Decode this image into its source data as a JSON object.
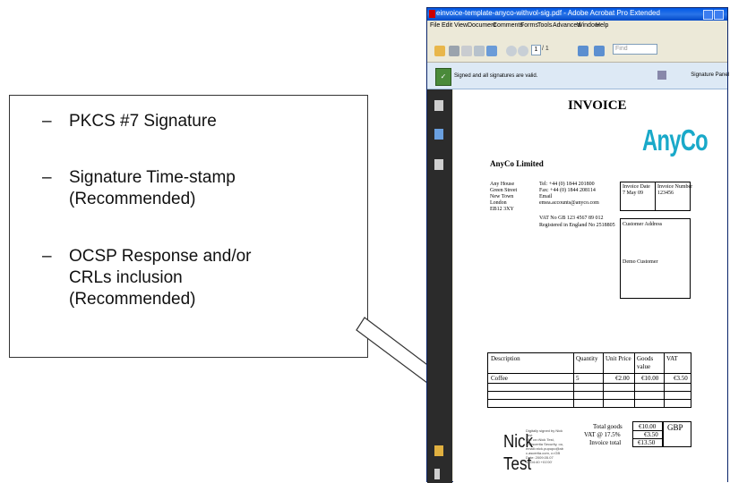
{
  "callout": {
    "bullets": [
      "PKCS #7 Signature",
      "Signature Time-stamp (Recommended)",
      "OCSP Response and/or CRLs inclusion (Recommended)"
    ],
    "dash": "–"
  },
  "window": {
    "title": "einvoice-template-anyco-withvol-sig.pdf - Adobe Acrobat Pro Extended",
    "menu": [
      "File",
      "Edit",
      "View",
      "Document",
      "Comments",
      "Forms",
      "Tools",
      "Advanced",
      "Window",
      "Help"
    ],
    "toolbar": {
      "page_value": "1",
      "page_count": "/ 1",
      "find_placeholder": "Find"
    },
    "signature_bar": {
      "message": "Signed and all signatures are valid.",
      "panel_button": "Signature Panel"
    }
  },
  "invoice": {
    "heading": "INVOICE",
    "logo": "AnyCo",
    "company": "AnyCo Limited",
    "address": [
      "Any House",
      "Green Street",
      "New Town",
      "London",
      "EB12 3XY"
    ],
    "contact": [
      "Tel: +44 (0) 1844 201800",
      "Fax: +44 (0) 1844 208114",
      "Email",
      "emea.accounts@anyco.com"
    ],
    "vat_no": "VAT No GB 123 4567 89 012",
    "registered": "Registered in England No 2518805",
    "invoice_date_label": "Invoice Date",
    "invoice_date": "7 May 09",
    "invoice_number_label": "Invoice Number",
    "invoice_number": "123456",
    "customer_address_label": "Customer Address",
    "customer_name": "Demo Customer",
    "table": {
      "headers": [
        "Description",
        "Quantity",
        "Unit Price",
        "Goods value",
        "VAT"
      ],
      "rows": [
        [
          "Coffee",
          "5",
          "€2.00",
          "€10.00",
          "€3.50"
        ]
      ]
    },
    "totals": {
      "total_goods_label": "Total goods",
      "total_goods": "€10.00",
      "vat_label": "VAT @ 17.5%",
      "vat": "€3.50",
      "invoice_total_label": "Invoice total",
      "invoice_total": "€13.50",
      "currency": "GBP"
    },
    "signature": {
      "first": "Nick",
      "last": "Test",
      "details": [
        "Digitally signed by Nick",
        "Test",
        "DN: cn=Nick Test,",
        "o=Ascertia Security, ou,",
        "email=nick.pupupo@ab",
        "c.ascertia.com, c=GB",
        "Date: 2009.05.07",
        "13:04:40 +01'00'"
      ]
    }
  },
  "colors": {
    "accent_logo": "#19a9c9",
    "titlebar": "#0058e6",
    "sig_valid": "#4a8a3a"
  }
}
